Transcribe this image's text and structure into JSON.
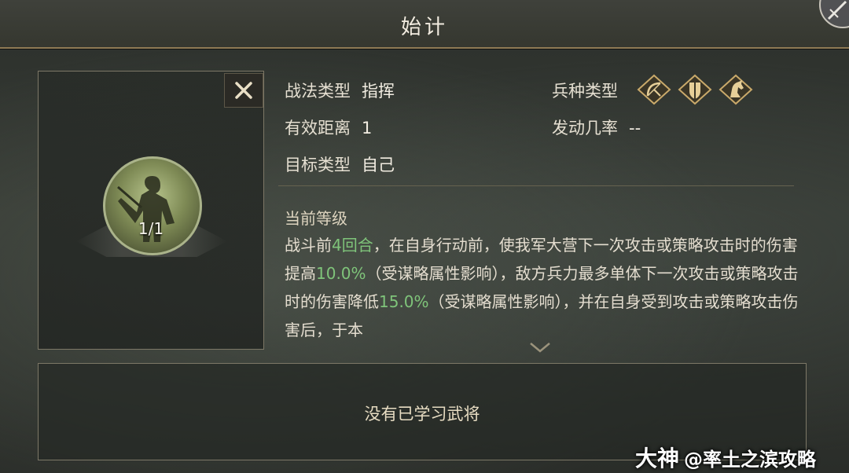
{
  "header": {
    "title": "始计"
  },
  "skill": {
    "level": "1/1",
    "close_icon": "close-icon"
  },
  "info": {
    "type_label": "战法类型",
    "type_value": "指挥",
    "range_label": "有效距离",
    "range_value": "1",
    "target_label": "目标类型",
    "target_value": "自己",
    "troop_label": "兵种类型",
    "troop_icons": [
      "bow-icon",
      "shield-icon",
      "horse-icon"
    ],
    "rate_label": "发动几率",
    "rate_value": "--"
  },
  "detail": {
    "section_title": "当前等级",
    "segments": [
      {
        "text": "战斗前",
        "hl": false
      },
      {
        "text": "4回合",
        "hl": true
      },
      {
        "text": "，在自身行动前，使我军大营下一次攻击或策略攻击时的伤害提高",
        "hl": false
      },
      {
        "text": "10.0%",
        "hl": true
      },
      {
        "text": "（受谋略属性影响），敌方兵力最多单体下一次攻击或策略攻击时的伤害降低",
        "hl": false
      },
      {
        "text": "15.0%",
        "hl": true
      },
      {
        "text": "（受谋略属性影响），并在自身受到攻击或策略攻击伤害后，于本",
        "hl": false
      }
    ],
    "highlight_color": "#7fc47a"
  },
  "generals": {
    "empty_text": "没有已学习武将"
  },
  "watermark": {
    "brand": "大神",
    "text": "@率土之滨攻略"
  }
}
